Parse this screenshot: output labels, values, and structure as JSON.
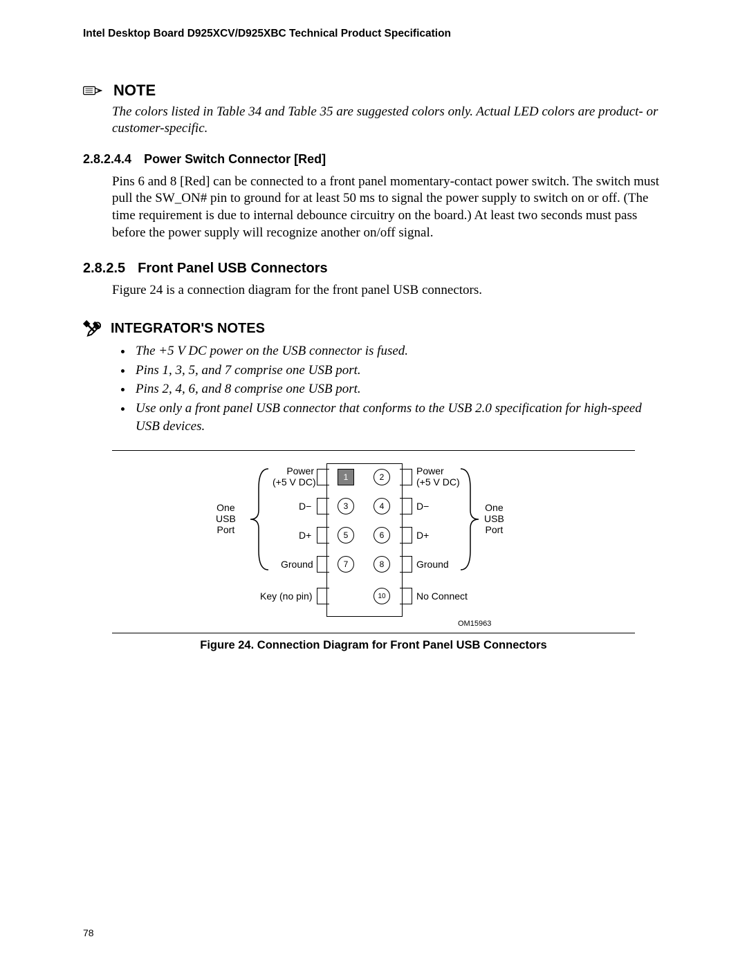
{
  "header": "Intel Desktop Board D925XCV/D925XBC Technical Product Specification",
  "note": {
    "heading": "NOTE",
    "body": "The colors listed in Table 34 and Table 35 are suggested colors only.  Actual LED colors are product- or customer-specific."
  },
  "sec_28244": {
    "num": "2.8.2.4.4",
    "title": "Power Switch Connector [Red]",
    "body": "Pins 6 and 8 [Red] can be connected to a front panel momentary-contact power switch.  The switch must pull the SW_ON# pin to ground for at least 50 ms to signal the power supply to switch on or off.  (The time requirement is due to internal debounce circuitry on the board.)  At least two seconds must pass before the power supply will recognize another on/off signal."
  },
  "sec_2825": {
    "num": "2.8.2.5",
    "title": "Front Panel USB Connectors",
    "body": "Figure 24 is a connection diagram for the front panel USB connectors."
  },
  "integrator": {
    "heading": "INTEGRATOR'S NOTES",
    "bullets": [
      "The +5 V DC power on the USB connector is fused.",
      "Pins 1, 3, 5, and 7 comprise one USB port.",
      "Pins 2, 4, 6, and 8 comprise one USB port.",
      "Use only a front panel USB connector that conforms to the USB 2.0 specification for high-speed USB devices."
    ]
  },
  "diagram": {
    "left_brace": "One\nUSB\nPort",
    "right_brace": "One\nUSB\nPort",
    "rows": [
      {
        "left_label": "Power\n(+5 V DC)",
        "left_pin": "1",
        "right_pin": "2",
        "right_label": "Power\n(+5 V DC)"
      },
      {
        "left_label": "D−",
        "left_pin": "3",
        "right_pin": "4",
        "right_label": "D−"
      },
      {
        "left_label": "D+",
        "left_pin": "5",
        "right_pin": "6",
        "right_label": "D+"
      },
      {
        "left_label": "Ground",
        "left_pin": "7",
        "right_pin": "8",
        "right_label": "Ground"
      },
      {
        "left_label": "Key (no pin)",
        "left_pin": "",
        "right_pin": "10",
        "right_label": "No  Connect"
      }
    ],
    "om": "OM15963",
    "caption": "Figure 24.  Connection Diagram for Front Panel USB Connectors"
  },
  "page_number": "78"
}
